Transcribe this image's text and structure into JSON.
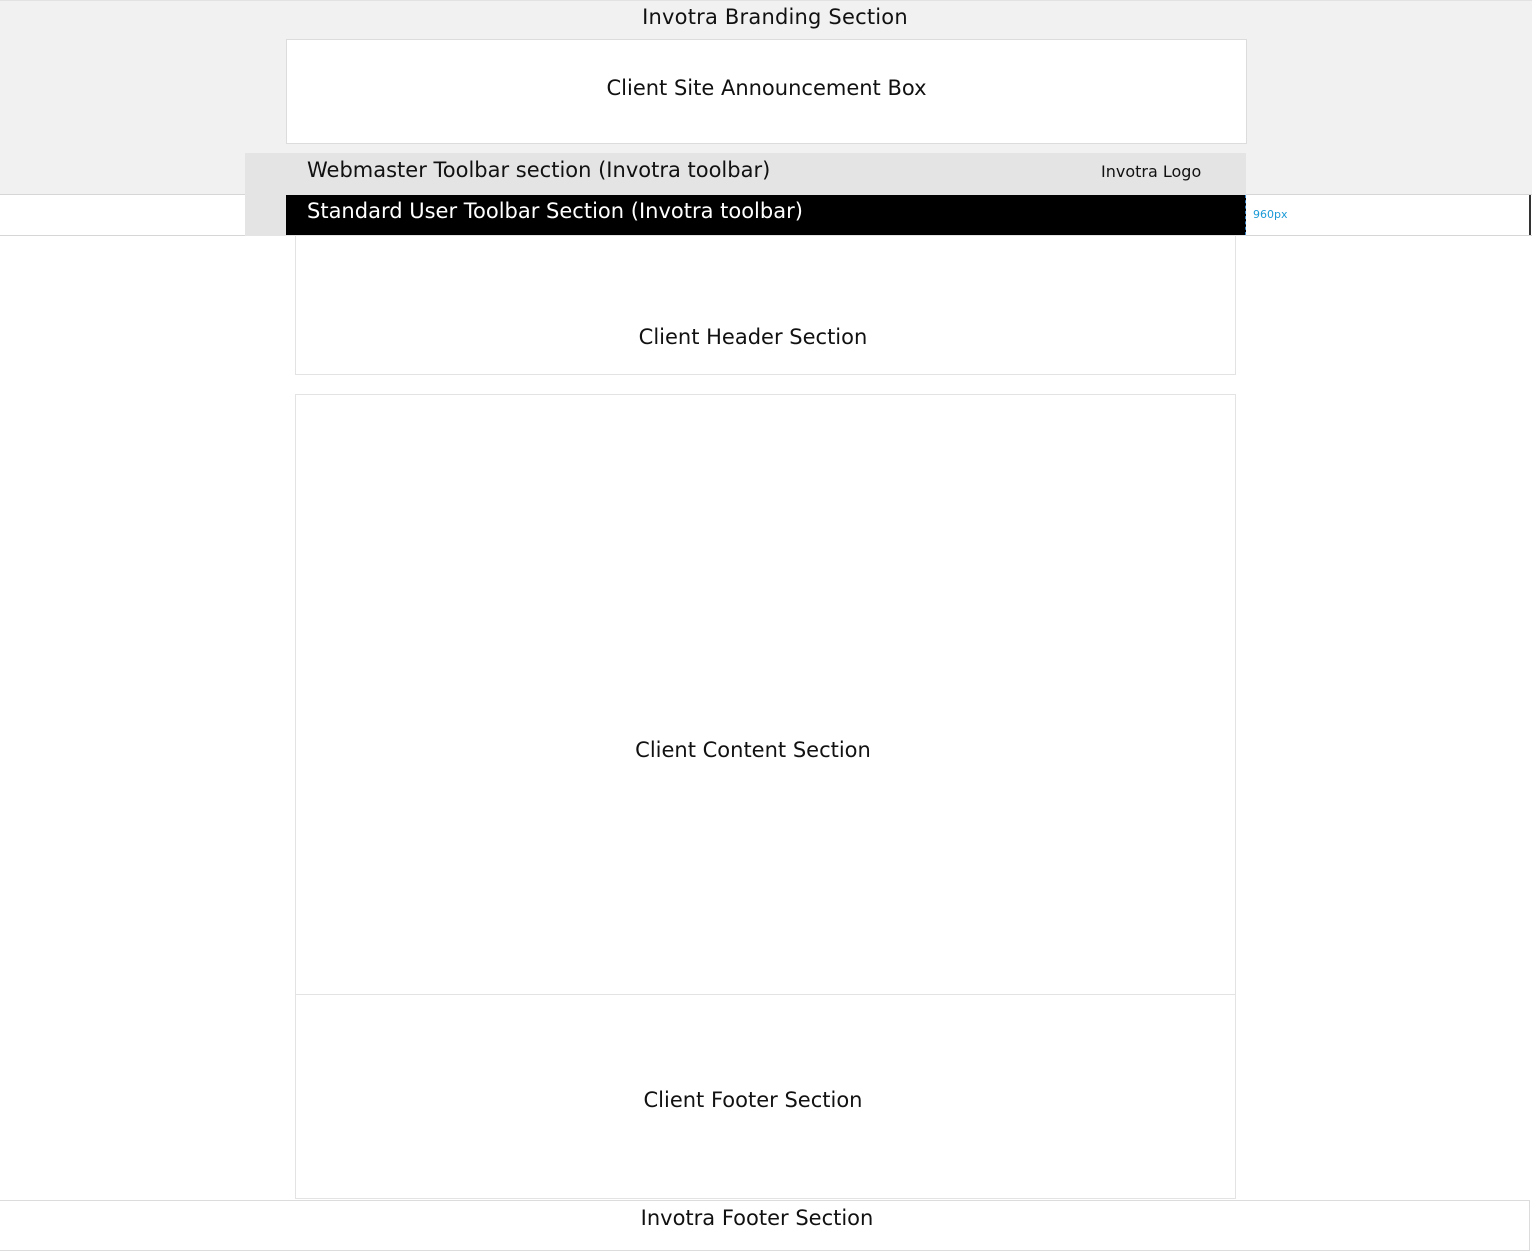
{
  "branding": {
    "title": "Invotra Branding Section"
  },
  "announcement": {
    "label": "Client Site Announcement Box"
  },
  "webmaster_toolbar": {
    "label": "Webmaster Toolbar section (Invotra toolbar)",
    "logo_label": "Invotra Logo"
  },
  "standard_toolbar": {
    "label": "Standard User Toolbar Section (Invotra toolbar)"
  },
  "annotation": {
    "width_label": "960px"
  },
  "client": {
    "header_label": "Client Header Section",
    "content_label": "Client Content Section",
    "footer_label": "Client Footer Section"
  },
  "footer": {
    "label": "Invotra Footer Section"
  },
  "colors": {
    "branding_background": "#f1f1f1",
    "webmaster_background": "#e4e4e4",
    "standard_toolbar_background": "#000000",
    "standard_toolbar_text": "#ffffff",
    "annotation_accent": "#1a9ad6"
  }
}
